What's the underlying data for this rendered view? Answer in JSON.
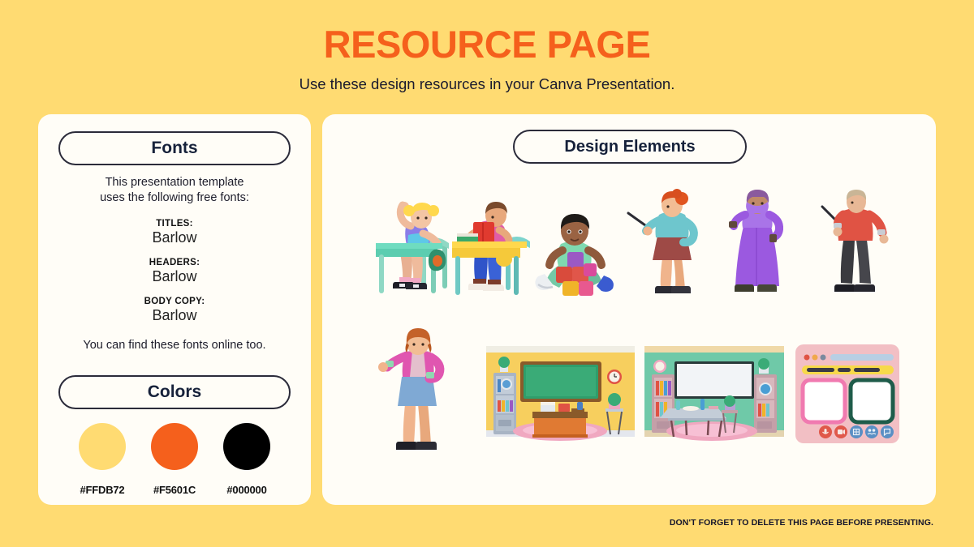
{
  "header": {
    "title": "RESOURCE PAGE",
    "subtitle": "Use these design resources in your Canva Presentation."
  },
  "fonts_panel": {
    "pill_label": "Fonts",
    "intro_line1": "This presentation template",
    "intro_line2": "uses the following free fonts:",
    "groups": [
      {
        "label": "TITLES:",
        "value": "Barlow"
      },
      {
        "label": "HEADERS:",
        "value": "Barlow"
      },
      {
        "label": "BODY COPY:",
        "value": "Barlow"
      }
    ],
    "online_note": "You can find these fonts online too."
  },
  "colors_panel": {
    "pill_label": "Colors",
    "swatches": [
      {
        "hex": "#FFDB72",
        "label": "#FFDB72"
      },
      {
        "hex": "#F5601C",
        "label": "#F5601C"
      },
      {
        "hex": "#000000",
        "label": "#000000"
      }
    ]
  },
  "design_elements": {
    "pill_label": "Design Elements",
    "items": [
      {
        "name": "student-raising-hand-at-desk",
        "desc": "Blonde girl with pigtails raising her hand at a green school desk"
      },
      {
        "name": "student-reading-at-desk",
        "desc": "Boy in pink shirt reading a red book at a yellow desk"
      },
      {
        "name": "child-playing-with-blocks",
        "desc": "Child in mint shirt sitting on the floor with colorful building blocks"
      },
      {
        "name": "teacher-woman-with-pointer",
        "desc": "Red-haired teacher in teal top and maroon skirt holding a pointer"
      },
      {
        "name": "teacher-woman-purple-dress",
        "desc": "Teacher in long purple dress and headscarf holding a pointer"
      },
      {
        "name": "teacher-man-with-pointer",
        "desc": "Man in red sweater and dark trousers holding a pointer"
      },
      {
        "name": "teacher-woman-standing",
        "desc": "Woman with auburn bob in pink cardigan and blue skirt"
      },
      {
        "name": "classroom-yellow-chalkboard",
        "desc": "Yellow classroom with green chalkboard, orange desk, bookshelf and clock"
      },
      {
        "name": "classroom-green-whiteboard",
        "desc": "Green classroom with white whiteboard, table, bookshelves and globe"
      },
      {
        "name": "online-class-window",
        "desc": "Pink video call window with two video panes and control buttons"
      }
    ]
  },
  "footer": {
    "note": "DON'T FORGET TO DELETE THIS PAGE BEFORE PRESENTING."
  }
}
